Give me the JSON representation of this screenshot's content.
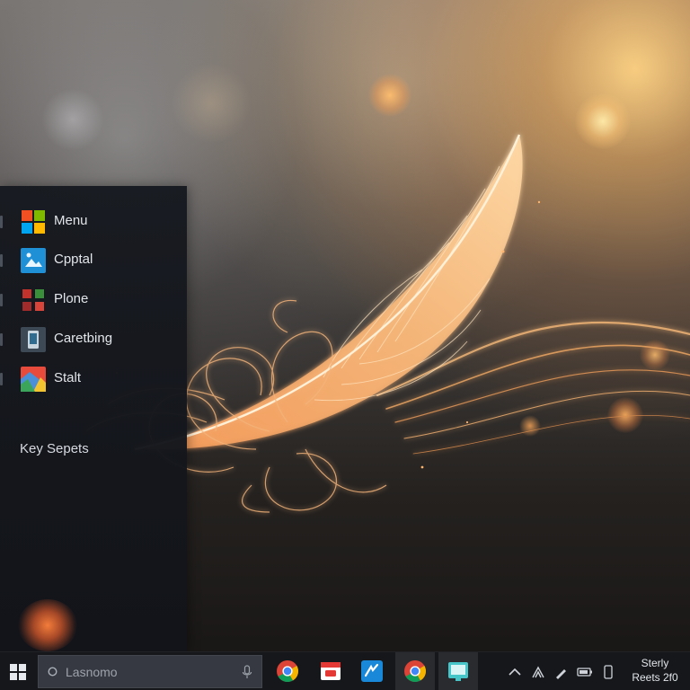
{
  "start_panel": {
    "items": [
      {
        "label": "Menu",
        "icon": "windows-tiles-icon"
      },
      {
        "label": "Cpptal",
        "icon": "photo-app-icon"
      },
      {
        "label": "Plone",
        "icon": "red-grid-icon"
      },
      {
        "label": "Caretbing",
        "icon": "device-icon"
      },
      {
        "label": "Stalt",
        "icon": "colorful-app-icon"
      }
    ],
    "section_label": "Key Sepets"
  },
  "taskbar": {
    "search_text": "Lasnomo",
    "apps": [
      {
        "name": "chrome",
        "icon": "chrome-icon"
      },
      {
        "name": "red-app",
        "icon": "red-app-icon"
      },
      {
        "name": "blue-app",
        "icon": "blue-app-icon"
      },
      {
        "name": "chrome-active",
        "icon": "chrome-icon",
        "active": true
      },
      {
        "name": "teal-app",
        "icon": "teal-app-icon",
        "active": true
      }
    ],
    "tray_icons": [
      "chevron-up-icon",
      "network-icon",
      "pen-icon",
      "battery-icon",
      "phone-icon"
    ],
    "clock": {
      "line1": "Sterly",
      "line2": "Reets 2f0"
    }
  },
  "colors": {
    "panel_bg": "#16191f",
    "taskbar_bg": "#16181c",
    "feather_glow": "#f7b06a",
    "accent_orange": "#ff8a3c"
  }
}
